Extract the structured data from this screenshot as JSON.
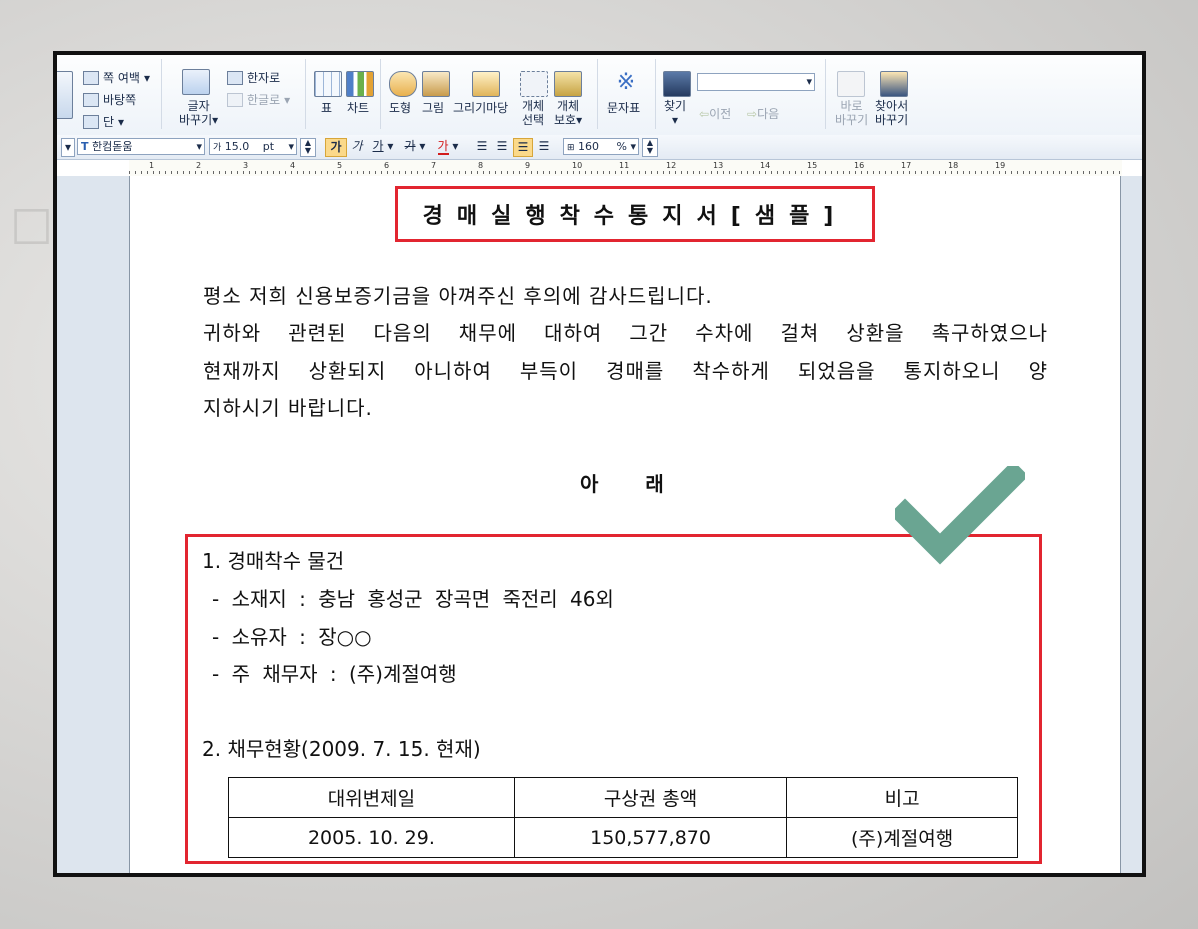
{
  "ribbon": {
    "page_margin": "쪽 여백",
    "background": "바탕쪽",
    "column": "단",
    "char_change": [
      "글자",
      "바꾸기"
    ],
    "to_hanja": "한자로",
    "to_hangul": "한글로",
    "table": "표",
    "chart": "차트",
    "shape": "도형",
    "picture": "그림",
    "drawing_yard": "그리기마당",
    "object_select": [
      "개체",
      "선택"
    ],
    "object_protect": [
      "개체",
      "보호"
    ],
    "symbol_table": "문자표",
    "find": "찾기",
    "find_input": "",
    "prev": "이전",
    "next": "다음",
    "direct_replace": [
      "바로",
      "바꾸기"
    ],
    "find_replace": [
      "찾아서",
      "바꾸기"
    ]
  },
  "format": {
    "font": "한컴돋움",
    "size": "15.0",
    "unit": "pt",
    "bold": "가",
    "italic": "가",
    "underline": "가",
    "strike": "가",
    "color": "가",
    "zoom": "160",
    "zoom_unit": "%"
  },
  "ruler": [
    "1",
    "2",
    "3",
    "4",
    "5",
    "6",
    "7",
    "8",
    "9",
    "10",
    "11",
    "12",
    "13",
    "14",
    "15",
    "16",
    "17",
    "18",
    "19"
  ],
  "doc": {
    "title": "경매실행착수통지서[샘플]",
    "para": [
      "평소 저희 신용보증기금을 아껴주신 후의에 감사드립니다.",
      "귀하와 관련된 다음의 채무에 대하여 그간 수차에 걸쳐 상환을 촉구하였으나",
      "현재까지 상환되지 아니하여 부득이 경매를 착수하게 되었음을 통지하오니 양",
      "지하시기 바랍니다."
    ],
    "section": "아 래",
    "item1": "1. 경매착수 물건",
    "item1_lines": [
      "- 소재지 : 충남 홍성군 장곡면 죽전리 46외",
      "- 소유자 : 장○○",
      "- 주 채무자 : (주)계절여행"
    ],
    "item2": "2. 채무현황(2009. 7. 15. 현재)",
    "table_headers": [
      "대위변제일",
      "구상권 총액",
      "비고"
    ],
    "table_row": [
      "2005. 10. 29.",
      "150,577,870",
      "(주)계절여행"
    ]
  },
  "colors": {
    "highlight": "#e22530",
    "check": "#6aa592"
  }
}
